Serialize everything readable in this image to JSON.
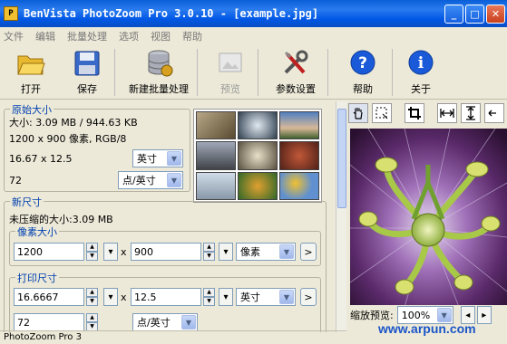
{
  "window": {
    "title": "BenVista PhotoZoom Pro 3.0.10 - [example.jpg]",
    "buttons": {
      "minimize": "_",
      "maximize": "□",
      "close": "✕"
    }
  },
  "menu": [
    "文件",
    "编辑",
    "批量处理",
    "选项",
    "视图",
    "帮助"
  ],
  "toolbar": {
    "open": "打开",
    "save": "保存",
    "batch": "新建批量处理",
    "preview": "预览",
    "settings": "参数设置",
    "help": "帮助",
    "about": "关于"
  },
  "original": {
    "title": "原始大小",
    "size_line": "大小: 3.09 MB / 944.63 KB",
    "dims_line": "1200 x 900 像素, RGB/8",
    "inches": "16.67 x 12.5",
    "unit": "英寸",
    "resolution": "72",
    "res_unit": "点/英寸"
  },
  "newsize": {
    "title": "新尺寸",
    "uncompressed": "未压缩的大小:3.09 MB",
    "pixel_group": "像素大小",
    "pixel_w": "1200",
    "pixel_h": "900",
    "pixel_unit": "像素",
    "times": "x",
    "print_group": "打印尺寸",
    "print_w": "16.6667",
    "print_h": "12.5",
    "print_unit": "英寸",
    "res": "72",
    "res_unit": "点/英寸"
  },
  "preview": {
    "zoom_label": "缩放预览:",
    "zoom_value": "100%"
  },
  "status": "PhotoZoom Pro 3",
  "watermark": "www.arpun.com"
}
